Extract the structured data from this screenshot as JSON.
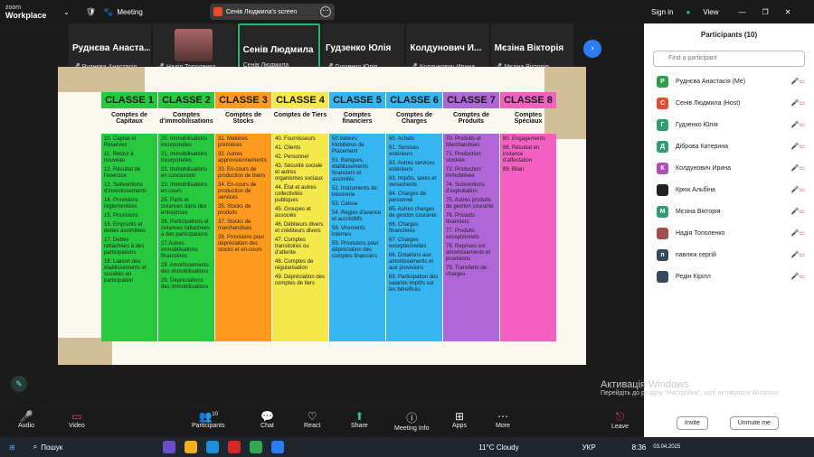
{
  "app": {
    "brand_small": "zoom",
    "brand_big": "Workplace",
    "meeting": "Meeting",
    "share_label": "Сенів Людмила's screen",
    "signin": "Sign in",
    "view": "View"
  },
  "tiles": [
    {
      "name": "Руднєва Анаста...",
      "sub": "Руднєва Анастасія"
    },
    {
      "name": "",
      "sub": "Надія Тополенко"
    },
    {
      "name": "Сенів Людмила",
      "sub": "Сенів Людмила"
    },
    {
      "name": "Гудзенко Юлія",
      "sub": "Гудзенко Юлія"
    },
    {
      "name": "Колдунович И...",
      "sub": "Колдунович Ирина"
    },
    {
      "name": "Мєзіна Вікторія",
      "sub": "Мєзіна Вікторія"
    }
  ],
  "slide": {
    "classes": [
      {
        "hd": "CLASSE 1",
        "sub": "Comptes de Capitaux",
        "color": "#27c93f",
        "items": [
          "10. Capital et Réserves",
          "11. Retour à nouveau",
          "12. Résultat de l'exercice",
          "13. Subventions d'investissements",
          "14. Provisions réglementées",
          "15. Provisions",
          "16. Emprunts et dettes assimilées",
          "17. Dettes rattachées à des participations",
          "18. Liaison des établissements et sociétés en participation"
        ]
      },
      {
        "hd": "CLASSE 2",
        "sub": "Comptes d'immobilisations",
        "color": "#27c93f",
        "items": [
          "20. Immobilisations incorporelles",
          "21. Immobilisations incorporelles",
          "22. Immobilisations en concession",
          "23. Immobilisations en cours",
          "25. Parts et créances dans des entreprises",
          "26. Participations et créances rattachées à des participations",
          "27.Autres immobilisations financières",
          "28. Amortissements des immobilisations",
          "29. Dépréciations des immobilisations"
        ]
      },
      {
        "hd": "CLASSE 3",
        "sub": "Comptes de Stocks",
        "color": "#ff9a1e",
        "items": [
          "31. Matières premières",
          "32. Autres approvisionnements",
          "33. En-cours de production de biens",
          "34. En-cours de production de services",
          "35. Stocks de produits",
          "37. Stocks de marchandises",
          "39. Provisions pour dépréciation des stocks et en-cours"
        ]
      },
      {
        "hd": "CLASSE 4",
        "sub": "Comptes de Tiers",
        "color": "#f4e84a",
        "items": [
          "40. Fournisseurs",
          "41. Clients",
          "42. Personnel",
          "43. Sécurité sociale et autres organismes sociaux",
          "44. État et autres collectivités publiques",
          "45. Groupes et associés",
          "46. Débiteurs divers et créditeurs divers",
          "47. Comptes transitoires ou d'attente",
          "48. Comptes de régularisation",
          "49. Dépréciation des comptes de tiers"
        ]
      },
      {
        "hd": "CLASSE 5",
        "sub": "Comptes financiers",
        "color": "#35b6f0",
        "items": [
          "50.Valeurs Mobilières de Placement",
          "51. Banques, établissements financiers et assimilés",
          "52. Instruments de trésorerie",
          "53. Caisse",
          "54. Régies d'avance et accréditifs",
          "58. Virements internes",
          "59. Provisions pour dépréciation des comptes financiers"
        ]
      },
      {
        "hd": "CLASSE 6",
        "sub": "Comptes de Charges",
        "color": "#35b6f0",
        "items": [
          "60. Achats",
          "61. Services extérieurs",
          "62. Autres services extérieurs",
          "63. Impôts, taxes et versements",
          "64. Charges de personnel",
          "65. Autres charges de gestion courante",
          "66. Charges financières",
          "67. Charges exceptionnelles",
          "68. Dotations aux amortissements et aux provisions",
          "69. Participation des salariés impôts sur les bénéfices"
        ]
      },
      {
        "hd": "CLASSE 7",
        "sub": "Comptes de Produits",
        "color": "#b066d6",
        "items": [
          "70. Produits et Marchandises",
          "71. Production stockée",
          "72. Production immobilisée",
          "74. Subventions d'exploitation",
          "75. Autres produits de gestion courante",
          "76. Produits financiers",
          "77. Produits exceptionnels",
          "78. Reprises sur amortissements et provisions",
          "79. Transferts de charges"
        ]
      },
      {
        "hd": "CLASSE 8",
        "sub": "Comptes Spéciaux",
        "color": "#f45fc2",
        "items": [
          "80. Engagements",
          "88. Résultat en instance d'affectation",
          "89. Bilan"
        ]
      }
    ]
  },
  "bottom": {
    "audio": "Audio",
    "video": "Video",
    "participants": "Participants",
    "participants_count": "10",
    "chat": "Chat",
    "react": "React",
    "share": "Share",
    "meeting_info": "Meeting Info",
    "apps": "Apps",
    "more": "More",
    "leave": "Leave"
  },
  "panel": {
    "title": "Participants (10)",
    "search_placeholder": "Find a participant",
    "invite": "Invite",
    "unmute": "Unmute me",
    "people": [
      {
        "n": "Руднєва Анастасія (Me)",
        "a": "Р",
        "c": "#2e9d4f"
      },
      {
        "n": "Сенів Людмила (Host)",
        "a": "С",
        "c": "#e04e2b"
      },
      {
        "n": "Гудзенко Юлія",
        "a": "Г",
        "c": "#2e9d6f"
      },
      {
        "n": "Діброва Катерина",
        "a": "Д",
        "c": "#2e9d6f"
      },
      {
        "n": "Колдунович Ирина",
        "a": "К",
        "c": "#b54fb8"
      },
      {
        "n": "Крюк Альбіна",
        "a": "",
        "c": "#222"
      },
      {
        "n": "Мєзіна Вікторія",
        "a": "М",
        "c": "#2e9d6f"
      },
      {
        "n": "Надія Тополенко",
        "a": "",
        "c": "#a05050"
      },
      {
        "n": "павлюк сергій",
        "a": "п",
        "c": "#34495e"
      },
      {
        "n": "Редін Кірілл",
        "a": "",
        "c": "#34495e"
      }
    ]
  },
  "windows": {
    "activate_title": "Активація Windows",
    "activate_sub": "Перейдіть до розділу \"Настройки\", щоб активувати Windows.",
    "search": "Пошук",
    "weather": "11°C Cloudy",
    "lang": "УКР",
    "lang2": "UKRE",
    "time": "8:36",
    "date": "03.04.2025"
  }
}
